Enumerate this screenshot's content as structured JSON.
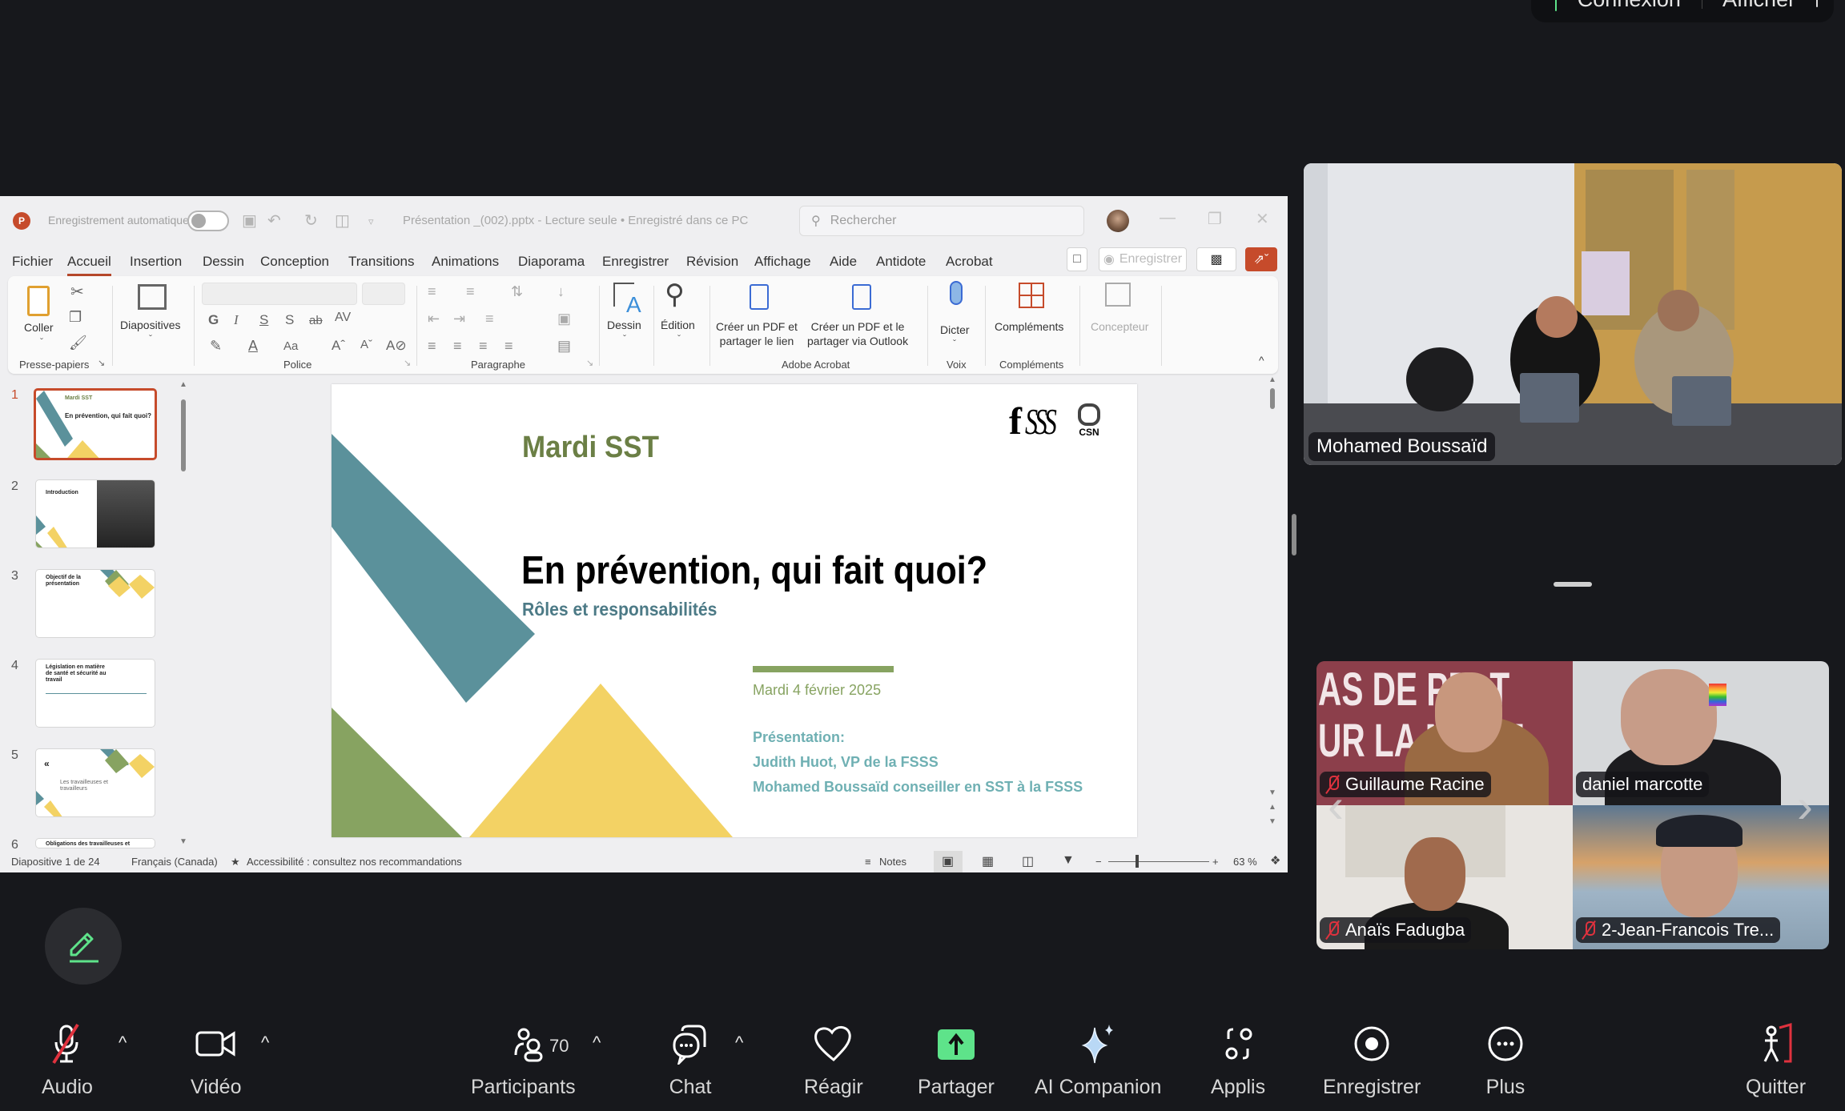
{
  "top_pill": {
    "connection_label": "Connexion",
    "view_label": "Afficher"
  },
  "powerpoint": {
    "autosave_label": "Enregistrement automatique",
    "document_title": "Présentation _(002).pptx  -  Lecture seule • Enregistré dans ce PC",
    "search_placeholder": "Rechercher",
    "tabs": [
      "Fichier",
      "Accueil",
      "Insertion",
      "Dessin",
      "Conception",
      "Transitions",
      "Animations",
      "Diaporama",
      "Enregistrer",
      "Révision",
      "Affichage",
      "Aide",
      "Antidote",
      "Acrobat"
    ],
    "active_tab": "Accueil",
    "record_button": "Enregistrer",
    "ribbon": {
      "paste": "Coller",
      "slides": "Diapositives",
      "drawing": "Dessin",
      "editing": "Édition",
      "pdf_link": [
        "Créer un PDF et",
        "partager le lien"
      ],
      "pdf_outlook": [
        "Créer un PDF et le",
        "partager via Outlook"
      ],
      "dictate": "Dicter",
      "addins": "Compléments",
      "designer": "Concepteur",
      "groups": {
        "clipboard": "Presse-papiers",
        "font": "Police",
        "paragraph": "Paragraphe",
        "acrobat": "Adobe Acrobat",
        "voice": "Voix",
        "addins": "Compléments"
      },
      "font_buttons": [
        "G",
        "I",
        "S",
        "S",
        "ab",
        "AV"
      ]
    },
    "thumbnails": [
      {
        "num": "1",
        "title": "Mardi SST",
        "subtitle": "En prévention, qui fait quoi?",
        "selected": true
      },
      {
        "num": "2",
        "title": "Introduction",
        "selected": false
      },
      {
        "num": "3",
        "title": "Objectif de la présentation",
        "selected": false
      },
      {
        "num": "4",
        "title": "Législation en matière de santé et sécurité au travail",
        "selected": false
      },
      {
        "num": "5",
        "title": "Les travailleuses et travailleurs",
        "selected": false
      },
      {
        "num": "6",
        "title": "Obligations des travailleuses et",
        "selected": false
      }
    ],
    "slide": {
      "kicker": "Mardi SST",
      "title": "En prévention, qui fait quoi?",
      "subtitle": "Rôles et responsabilités",
      "date": "Mardi 4 février 2025",
      "presenters_label": "Présentation:",
      "presenter_1": "Judith Huot, VP de la FSSS",
      "presenter_2": "Mohamed Boussaïd conseiller en SST à la FSSS",
      "logo_f": "f",
      "logo_sss": "SSS",
      "logo_csn": "CSN",
      "colors": {
        "teal": "#5b919b",
        "green": "#87a361",
        "yellow": "#f3d264",
        "kicker": "#6b7f45",
        "subtitle": "#4c7a86",
        "presenters": "#6fb0b3"
      }
    },
    "status_bar": {
      "slide_counter": "Diapositive 1 de 24",
      "language": "Français (Canada)",
      "accessibility": "Accessibilité : consultez nos recommandations",
      "notes": "Notes",
      "zoom": "63 %"
    }
  },
  "meeting": {
    "main_speaker": "Mohamed Boussaïd",
    "participants_grid": [
      {
        "name": "Guillaume Racine",
        "muted": true
      },
      {
        "name": "daniel marcotte",
        "muted": false
      },
      {
        "name": "Anaïs Fadugba",
        "muted": true
      },
      {
        "name": "2-Jean-Francois Tre...",
        "muted": true
      }
    ],
    "grid_background_text": [
      "AS DE PR  T",
      "UR LA M  DIE"
    ],
    "toolbar": {
      "audio": "Audio",
      "video": "Vidéo",
      "participants": "Participants",
      "participant_count": "70",
      "chat": "Chat",
      "react": "Réagir",
      "share": "Partager",
      "ai": "AI Companion",
      "apps": "Applis",
      "record": "Enregistrer",
      "more": "Plus",
      "leave": "Quitter"
    },
    "accent_share": "#5ee38a",
    "accent_leave": "#e0323e"
  }
}
